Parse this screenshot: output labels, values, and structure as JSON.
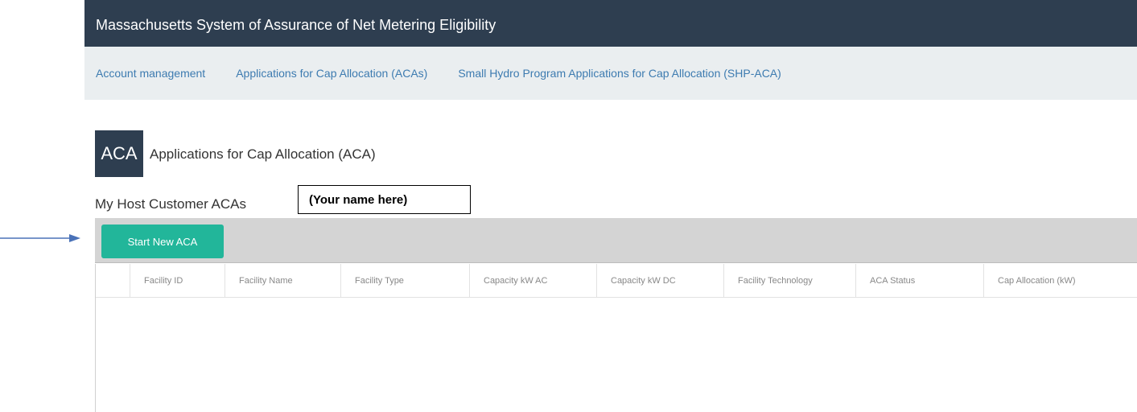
{
  "header": {
    "title": "Massachusetts System of Assurance of Net Metering Eligibility"
  },
  "nav": {
    "items": [
      {
        "label": "Account management"
      },
      {
        "label": "Applications for Cap Allocation (ACAs)"
      },
      {
        "label": "Small Hydro Program Applications for Cap Allocation (SHP-ACA)"
      }
    ]
  },
  "section": {
    "badge": "ACA",
    "title": "Applications for Cap Allocation (ACA)",
    "subheading": "My Host Customer ACAs",
    "name_placeholder": "(Your name here)"
  },
  "toolbar": {
    "start_label": "Start New ACA"
  },
  "grid": {
    "columns": [
      "",
      "Facility ID",
      "Facility Name",
      "Facility Type",
      "Capacity kW AC",
      "Capacity kW DC",
      "Facility Technology",
      "ACA Status",
      "Cap Allocation (kW)"
    ],
    "rows": []
  },
  "colors": {
    "header_bg": "#2e3e50",
    "nav_bg": "#eaeef0",
    "link": "#3d7bb0",
    "button": "#22b69a",
    "toolbar_bg": "#d4d4d4",
    "arrow": "#4a72b8"
  },
  "icons": {
    "arrow": "right-arrow-icon"
  }
}
